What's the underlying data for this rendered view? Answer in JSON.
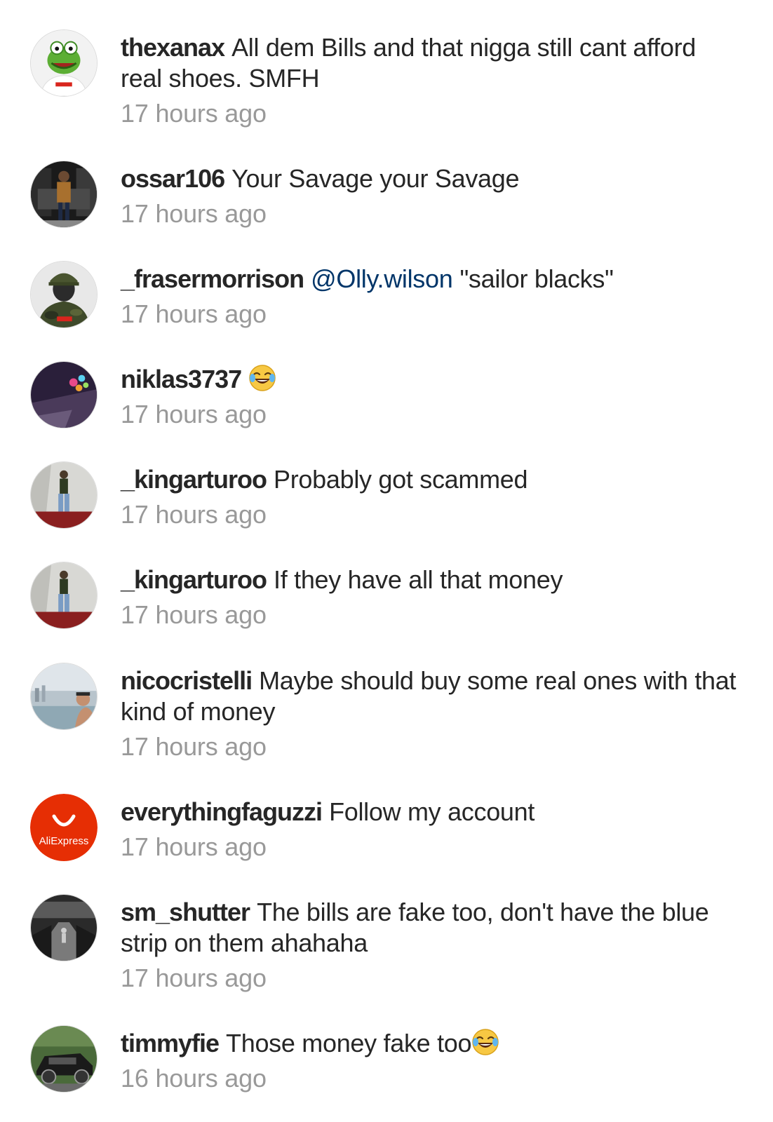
{
  "comments": [
    {
      "username": "thexanax",
      "text": "All dem Bills and that nigga still cant afford real shoes. SMFH",
      "time": "17 hours ago",
      "avatar": "kermit-avatar"
    },
    {
      "username": "ossar106",
      "text": "Your Savage your Savage",
      "time": "17 hours ago",
      "avatar": "man-by-car-avatar"
    },
    {
      "username": "_frasermorrison",
      "mention": "@Olly.wilson",
      "text": "\"sailor blacks\"",
      "time": "17 hours ago",
      "avatar": "camo-avatar"
    },
    {
      "username": "niklas3737",
      "emoji": "face-with-tears-of-joy",
      "time": "17 hours ago",
      "avatar": "balloons-avatar"
    },
    {
      "username": "_kingarturoo",
      "text": "Probably got scammed",
      "time": "17 hours ago",
      "avatar": "person-standing-avatar"
    },
    {
      "username": "_kingarturoo",
      "text": "If they have all that money",
      "time": "17 hours ago",
      "avatar": "person-standing-avatar"
    },
    {
      "username": "nicocristelli",
      "text": "Maybe should buy some real ones with that kind of money",
      "time": "17 hours ago",
      "avatar": "beach-selfie-avatar"
    },
    {
      "username": "everythingfaguzzi",
      "text": "Follow my account",
      "time": "17 hours ago",
      "avatar": "aliexpress-logo-avatar",
      "avatar_text": "AliExpress"
    },
    {
      "username": "sm_shutter",
      "text": "The bills are fake too, don't have the blue strip on them ahahaha",
      "time": "17 hours ago",
      "avatar": "bw-street-avatar"
    },
    {
      "username": "timmyfie",
      "text": "Those money fake too",
      "emoji": "face-with-tears-of-joy",
      "time": "16 hours ago",
      "avatar": "car-avatar"
    }
  ],
  "colors": {
    "username": "#262626",
    "text": "#262626",
    "mention": "#003569",
    "timestamp": "#999999",
    "aliexpress": "#e62e04"
  }
}
